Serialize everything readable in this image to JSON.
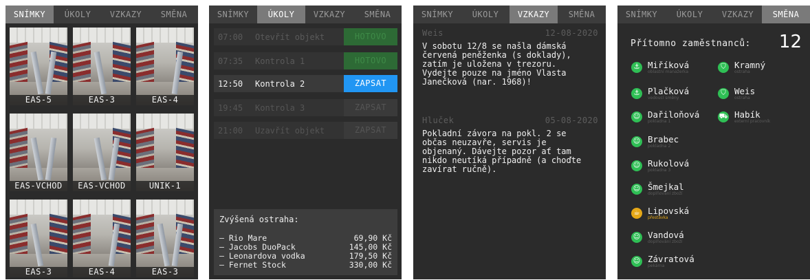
{
  "tabs": [
    "SNÍMKY",
    "ÚKOLY",
    "VZKAZY",
    "SMĚNA"
  ],
  "snapshots": {
    "cameras": [
      "EAS-5",
      "EAS-3",
      "EAS-4",
      "EAS-VCHOD",
      "EAS-VCHOD",
      "UNIK-1",
      "EAS-3",
      "EAS-4",
      "EAS-3"
    ]
  },
  "tasks": {
    "items": [
      {
        "time": "07:00",
        "name": "Otevřít objekt",
        "action": "HOTOVO",
        "state": "done"
      },
      {
        "time": "07:35",
        "name": "Kontrola 1",
        "action": "HOTOVO",
        "state": "done"
      },
      {
        "time": "12:50",
        "name": "Kontrola 2",
        "action": "ZAPSAT",
        "state": "current"
      },
      {
        "time": "19:45",
        "name": "Kontrola 3",
        "action": "ZAPSAT",
        "state": "future"
      },
      {
        "time": "21:00",
        "name": "Uzavřít objekt",
        "action": "ZAPSAT",
        "state": "future"
      }
    ],
    "alert": {
      "title": "Zvýšená ostraha:",
      "items": [
        {
          "name": "– Rio Mare",
          "price": "69,90 Kč"
        },
        {
          "name": "– Jacobs DuoPack",
          "price": "145,00 Kč"
        },
        {
          "name": "– Leonardova vodka",
          "price": "179,50 Kč"
        },
        {
          "name": "– Fernet Stock",
          "price": "330,00 Kč"
        }
      ]
    }
  },
  "messages": [
    {
      "author": "Weis",
      "date": "12-08-2020",
      "text": "V sobotu 12/8 se našla dámská\nčervená peněženka (s doklady),\nzatím je uložena v trezoru.\nVydejte pouze na jméno Vlasta\nJanečková (nar. 1968)!"
    },
    {
      "author": "Hluček",
      "date": "05-08-2020",
      "text": "Pokladní závora na pokl. 2 se\nobčas neuzavře, servis je\nobjenaný. Dávejte pozor ať tam\nnikdo neutíká případně (a choďte\nzavírat ručně)."
    }
  ],
  "shift": {
    "present_label": "Přítomno zaměstnanců:",
    "present_count": "12",
    "employees": [
      {
        "name": "Miříková",
        "role": "oblastní manažerka",
        "icon": "anchor-icon"
      },
      {
        "name": "Plačková",
        "role": "vedoucí směny",
        "icon": "anchor-icon"
      },
      {
        "name": "Dařiloňová",
        "role": "pokladna 1",
        "icon": "person-icon"
      },
      {
        "name": "Brabec",
        "role": "pokladna 2",
        "icon": "person-icon"
      },
      {
        "name": "Rukolová",
        "role": "pokladna 3",
        "icon": "person-icon"
      },
      {
        "name": "Šmejkal",
        "role": "doplňování zboží",
        "icon": "person-icon"
      },
      {
        "name": "Lipovská",
        "role": "přestávka",
        "icon": "coffee-icon"
      },
      {
        "name": "Vandová",
        "role": "doplňování zboží",
        "icon": "person-icon"
      },
      {
        "name": "Závratová",
        "role": "pekárna",
        "icon": "person-icon"
      },
      {
        "name": "Kramný",
        "role": "ostraha",
        "icon": "shield-icon"
      },
      {
        "name": "Weis",
        "role": "ostraha",
        "icon": "shield-icon"
      },
      {
        "name": "Habík",
        "role": "externí pracovník",
        "icon": "truck-icon"
      }
    ]
  },
  "colors": {
    "done": "#2d6a35",
    "action": "#2196f3",
    "staff": "#2fbf55",
    "break": "#e6a817"
  }
}
